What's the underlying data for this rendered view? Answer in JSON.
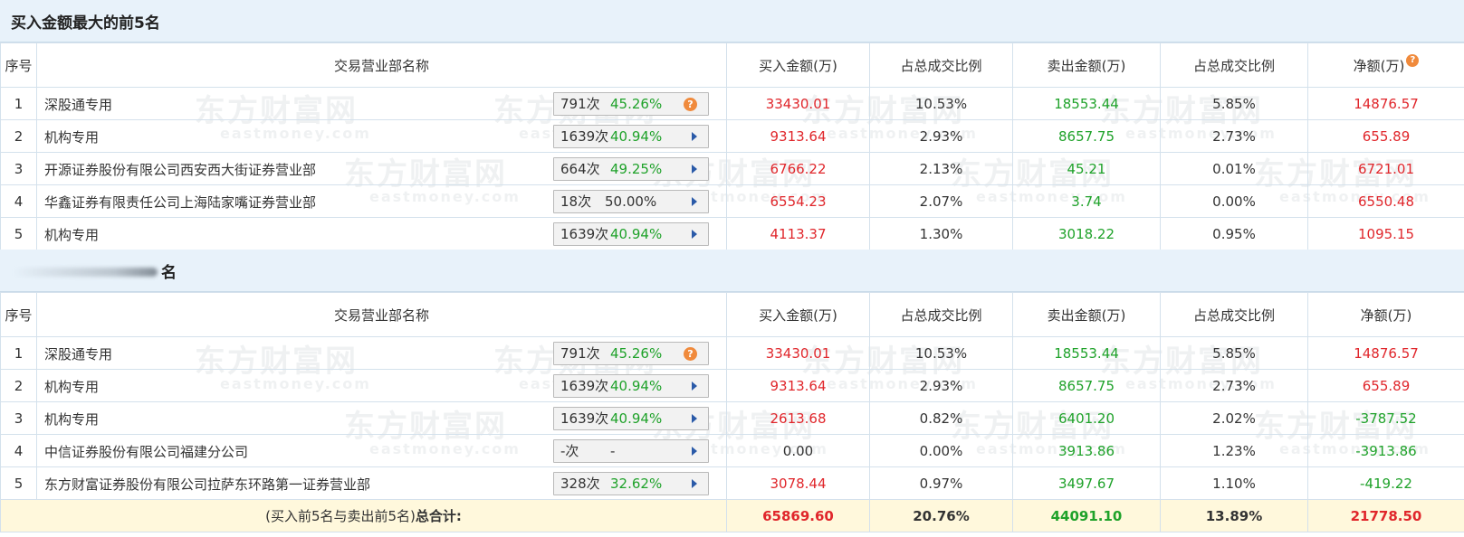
{
  "buy_section": {
    "title": "买入金额最大的前5名",
    "headers": [
      "序号",
      "交易营业部名称",
      "买入金额(万)",
      "占总成交比例",
      "卖出金额(万)",
      "占总成交比例",
      "净额(万)"
    ],
    "net_help_icon": "question-circle-icon",
    "rows": [
      {
        "no": "1",
        "name": "深股通专用",
        "count": "791次",
        "pct": "45.26%",
        "icon": "question-circle-icon",
        "buy": "33430.01",
        "buy_ratio": "10.53%",
        "sell": "18553.44",
        "sell_ratio": "5.85%",
        "net": "14876.57"
      },
      {
        "no": "2",
        "name": "机构专用",
        "count": "1639次",
        "pct": "40.94%",
        "icon": "arrow-right-icon",
        "buy": "9313.64",
        "buy_ratio": "2.93%",
        "sell": "8657.75",
        "sell_ratio": "2.73%",
        "net": "655.89"
      },
      {
        "no": "3",
        "name": "开源证券股份有限公司西安西大街证券营业部",
        "count": "664次",
        "pct": "49.25%",
        "icon": "arrow-right-icon",
        "buy": "6766.22",
        "buy_ratio": "2.13%",
        "sell": "45.21",
        "sell_ratio": "0.01%",
        "net": "6721.01"
      },
      {
        "no": "4",
        "name": "华鑫证券有限责任公司上海陆家嘴证券营业部",
        "count": "18次",
        "pct": "50.00%",
        "icon": "arrow-right-icon",
        "buy": "6554.23",
        "buy_ratio": "2.07%",
        "sell": "3.74",
        "sell_ratio": "0.00%",
        "net": "6550.48"
      },
      {
        "no": "5",
        "name": "机构专用",
        "count": "1639次",
        "pct": "40.94%",
        "icon": "arrow-right-icon",
        "buy": "4113.37",
        "buy_ratio": "1.30%",
        "sell": "3018.22",
        "sell_ratio": "0.95%",
        "net": "1095.15"
      }
    ]
  },
  "sell_section": {
    "title_visible_part": "名",
    "headers": [
      "序号",
      "交易营业部名称",
      "买入金额(万)",
      "占总成交比例",
      "卖出金额(万)",
      "占总成交比例",
      "净额(万)"
    ],
    "rows": [
      {
        "no": "1",
        "name": "深股通专用",
        "count": "791次",
        "pct": "45.26%",
        "icon": "question-circle-icon",
        "buy": "33430.01",
        "buy_ratio": "10.53%",
        "sell": "18553.44",
        "sell_ratio": "5.85%",
        "net": "14876.57"
      },
      {
        "no": "2",
        "name": "机构专用",
        "count": "1639次",
        "pct": "40.94%",
        "icon": "arrow-right-icon",
        "buy": "9313.64",
        "buy_ratio": "2.93%",
        "sell": "8657.75",
        "sell_ratio": "2.73%",
        "net": "655.89"
      },
      {
        "no": "3",
        "name": "机构专用",
        "count": "1639次",
        "pct": "40.94%",
        "icon": "arrow-right-icon",
        "buy": "2613.68",
        "buy_ratio": "0.82%",
        "sell": "6401.20",
        "sell_ratio": "2.02%",
        "net": "-3787.52"
      },
      {
        "no": "4",
        "name": "中信证券股份有限公司福建分公司",
        "count": "-次",
        "pct": "-",
        "icon": "arrow-right-icon",
        "buy": "0.00",
        "buy_ratio": "0.00%",
        "sell": "3913.86",
        "sell_ratio": "1.23%",
        "net": "-3913.86"
      },
      {
        "no": "5",
        "name": "东方财富证券股份有限公司拉萨东环路第一证券营业部",
        "count": "328次",
        "pct": "32.62%",
        "icon": "arrow-right-icon",
        "buy": "3078.44",
        "buy_ratio": "0.97%",
        "sell": "3497.67",
        "sell_ratio": "1.10%",
        "net": "-419.22"
      }
    ],
    "total": {
      "label_prefix": "(买入前5名与卖出前5名)",
      "label_bold": "总合计:",
      "buy": "65869.60",
      "buy_ratio": "20.76%",
      "sell": "44091.10",
      "sell_ratio": "13.89%",
      "net": "21778.50"
    }
  },
  "watermark": {
    "cn": "东方财富网",
    "en": "eastmoney.com"
  },
  "colors": {
    "positive": "#e0262b",
    "negative_sell": "#1fa22a",
    "header_bg": "#e8f2fa",
    "total_bg": "#fff8dc",
    "icon_orange": "#f08a3c",
    "arrow_blue": "#2a5aa8"
  }
}
